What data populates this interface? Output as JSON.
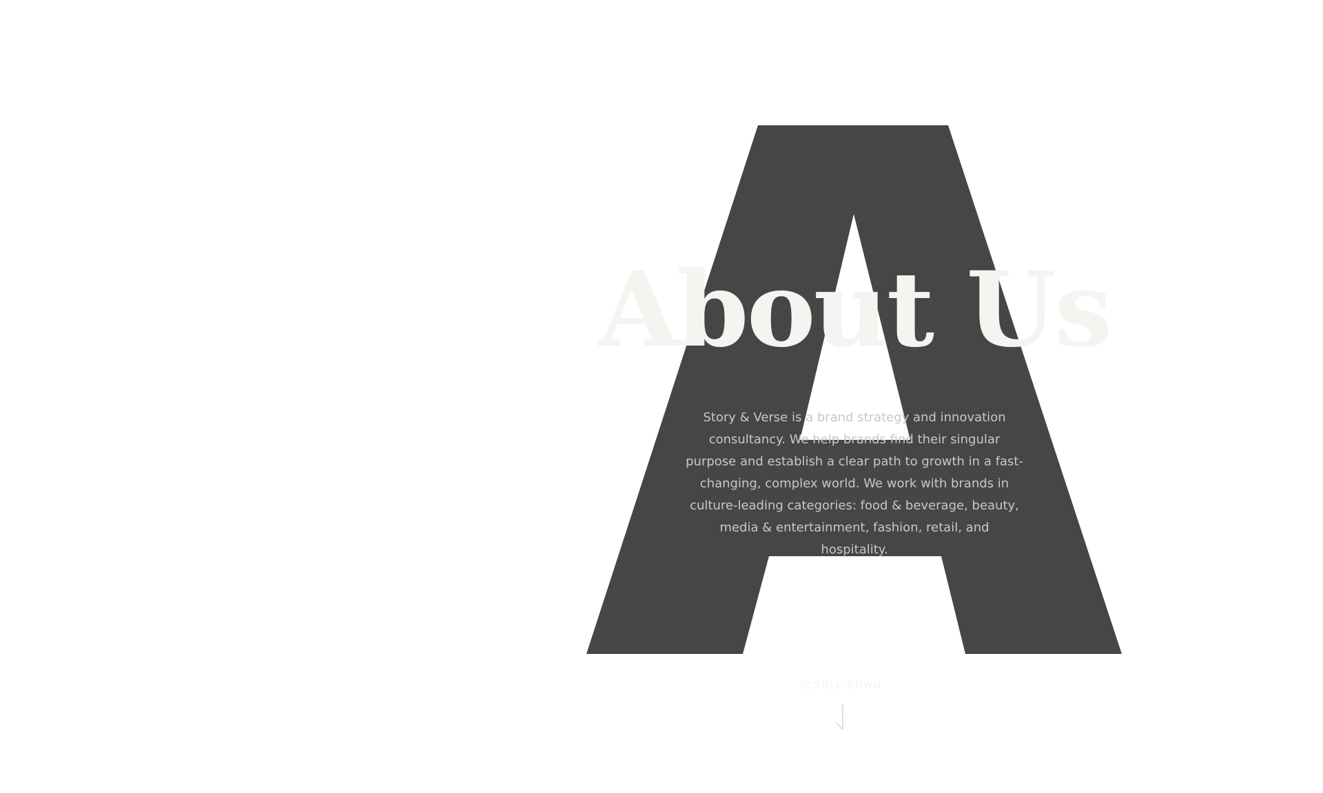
{
  "colors": {
    "letter": "#474647",
    "title": "#f5f4f0",
    "body_text": "#c8c8c8",
    "scroll_label": "#ececec",
    "scroll_arrow": "#d4d4d4",
    "background": "#ffffff"
  },
  "hero": {
    "letter_icon": "letter-a-icon",
    "title": "About Us",
    "body": "Story & Verse is a brand strategy and innovation consultancy. We help brands find their singular purpose and establish a clear path to growth in a fast-changing, complex world. We work with brands in culture-leading categories: food & beverage, beauty, media & entertainment, fashion, retail, and hospitality."
  },
  "scroll": {
    "label": "SCROLL DOWN",
    "icon": "arrow-down-icon"
  }
}
